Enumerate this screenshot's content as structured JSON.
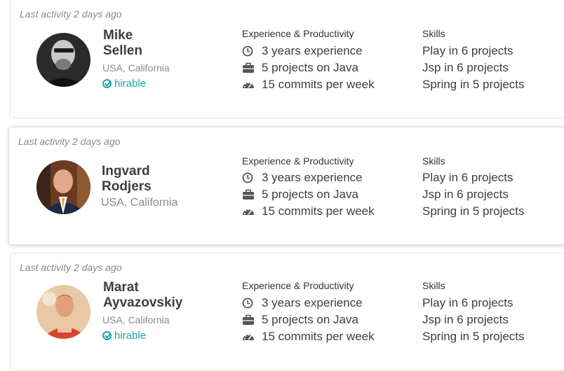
{
  "experience_title": "Experience & Productivity",
  "skills_title": "Skills",
  "profiles": [
    {
      "last_activity": "Last activity 2 days ago",
      "first_name": "Mike",
      "last_name": "Sellen",
      "location": "USA, California",
      "hirable": "hirable",
      "stats": [
        "3 years experience",
        "5 projects on Java",
        "15 commits per week"
      ],
      "skills": [
        "Play in 6 projects",
        "Jsp in 6 projects",
        "Spring in 5 projects"
      ]
    },
    {
      "last_activity": "Last activity 2 days ago",
      "first_name": "Ingvard",
      "last_name": "Rodjers",
      "location": "USA, California",
      "stats": [
        "3 years experience",
        "5 projects on Java",
        "15 commits per week"
      ],
      "skills": [
        "Play in 6 projects",
        "Jsp in 6 projects",
        "Spring in 5 projects"
      ]
    },
    {
      "last_activity": "Last activity 2 days ago",
      "first_name": "Marat",
      "last_name": "Ayvazovskiy",
      "location": "USA, California",
      "hirable": "hirable",
      "stats": [
        "3 years experience",
        "5 projects on Java",
        "15 commits per week"
      ],
      "skills": [
        "Play in 6 projects",
        "Jsp in 6 projects",
        "Spring in 5 projects"
      ]
    }
  ],
  "colors": {
    "accent": "#1aa3a8",
    "muted": "#8a8a8a",
    "text": "#3d3d3d",
    "icon": "#555555"
  },
  "icons": [
    "clock-icon",
    "briefcase-icon",
    "speedometer-icon",
    "check-circle-icon"
  ]
}
